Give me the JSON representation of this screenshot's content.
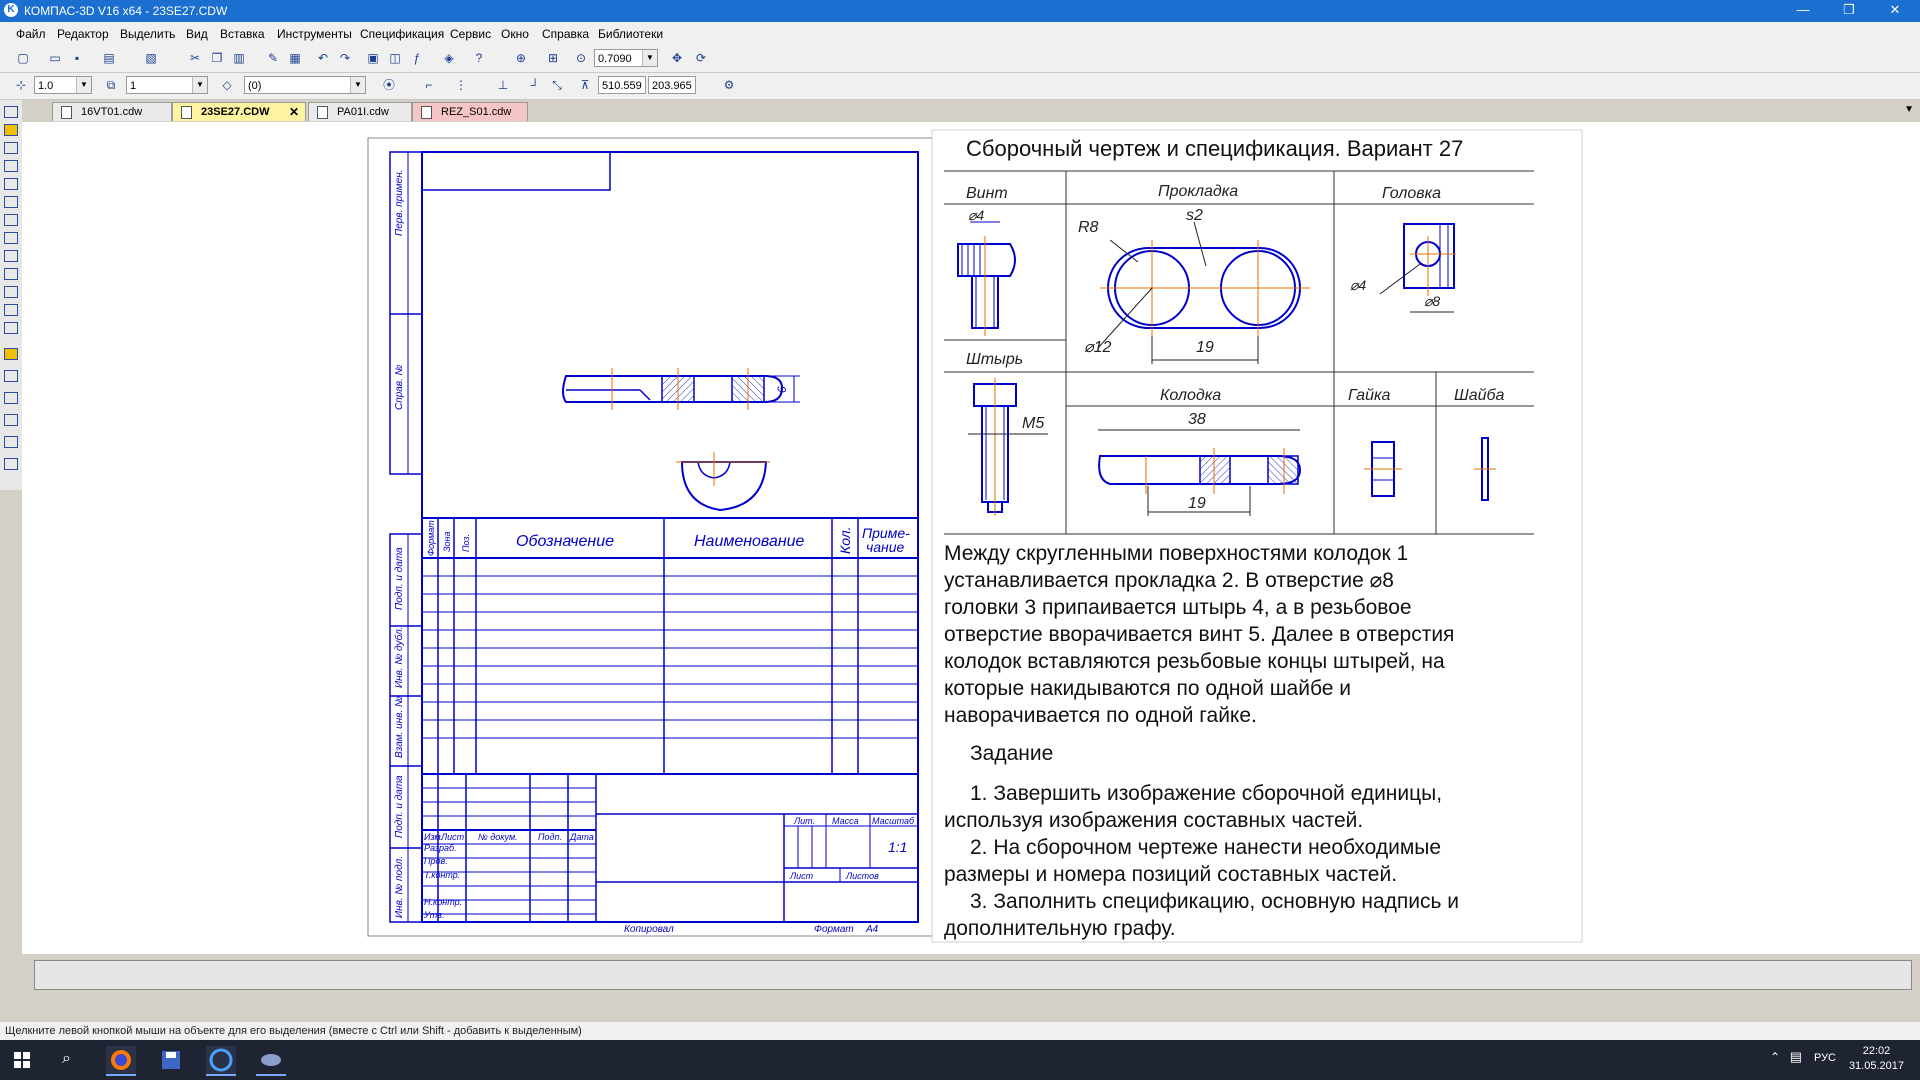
{
  "window": {
    "title": "КОМПАС-3D V16 x64 - 23SE27.CDW",
    "minimize": "—",
    "restore": "❐",
    "close": "✕"
  },
  "menu": [
    "Файл",
    "Редактор",
    "Выделить",
    "Вид",
    "Вставка",
    "Инструменты",
    "Спецификация",
    "Сервис",
    "Окно",
    "Справка",
    "Библиотеки"
  ],
  "toolbar1": {
    "zoom_value": "0.7090"
  },
  "toolbar2": {
    "step_value": "1.0",
    "angle_value": "1",
    "layer_value": "(0)",
    "coord_x": "510.559",
    "coord_y": "203.965"
  },
  "tabs": [
    {
      "label": "16VT01.cdw"
    },
    {
      "label": "23SE27.CDW",
      "close": "✕"
    },
    {
      "label": "PA01I.cdw"
    },
    {
      "label": "REZ_S01.cdw"
    }
  ],
  "drawing": {
    "side_labels": [
      "Перв. примен.",
      "Справ. №",
      "Подп. и дата",
      "Инв. № дубл.",
      "Взам. инв. №",
      "Подп. и дата",
      "Инв. № подл."
    ],
    "dim_6": "6",
    "spec_headers": {
      "format": "Формат",
      "zone": "Зона",
      "pos": "Поз.",
      "designation": "Обозначение",
      "name": "Наименование",
      "qty": "Кол.",
      "note1": "Приме-",
      "note2": "чание"
    },
    "stamp": {
      "izm": "Изм.",
      "list": "Лист",
      "doc": "№ докум.",
      "sign": "Подп.",
      "date": "Дата",
      "razrab": "Разраб.",
      "prov": "Пров.",
      "tkontr": "Т.контр.",
      "nkontr": "Н.контр.",
      "utv": "Утв.",
      "lit": "Лит.",
      "mass": "Масса",
      "scale": "Масштаб",
      "scale_value": "1:1",
      "sheet": "Лист",
      "sheets": "Листов"
    },
    "bottom_copy": "Копировал",
    "bottom_format": "Формат",
    "bottom_format_value": "А4"
  },
  "task": {
    "title": "Сборочный чертеж и спецификация.   Вариант 27",
    "parts": {
      "vint": "Винт",
      "vint_dim": "⌀4",
      "prokladka": "Прокладка",
      "r8": "R8",
      "s2": "s2",
      "d12": "⌀12",
      "dim19a": "19",
      "golovka": "Головка",
      "d4": "⌀4",
      "d8": "⌀8",
      "shtyr": "Штырь",
      "m5": "M5",
      "kolodka": "Колодка",
      "dim38": "38",
      "dim19b": "19",
      "gayka": "Гайка",
      "shayba": "Шайба"
    },
    "description": [
      "Между скругленными поверхностями колодок 1",
      "устанавливается прокладка 2. В отверстие ⌀8",
      "головки 3 припаивается штырь 4, а в резьбовое",
      "отверстие вворачивается винт 5. Далее в отверстия",
      "колодок вставляются резьбовые концы штырей, на",
      "которые накидываются  по одной шайбе и",
      "наворачивается по одной гайке."
    ],
    "assignment_title": "Задание",
    "assignment": [
      "1. Завершить изображение сборочной единицы,",
      "используя изображения составных частей.",
      "2. На сборочном чертеже нанести необходимые",
      "размеры и номера позиций составных частей.",
      "3. Заполнить спецификацию, основную надпись и",
      "дополнительную графу."
    ]
  },
  "status": {
    "hint": "Щелкните левой кнопкой мыши на объекте для его выделения (вместе с Ctrl или Shift - добавить к выделенным)"
  },
  "taskbar": {
    "lang": "РУС",
    "time": "22:02",
    "date": "31.05.2017"
  },
  "colors": {
    "line": "#0000cc",
    "axis": "#e07000",
    "titlebar": "#1a6fd1"
  }
}
